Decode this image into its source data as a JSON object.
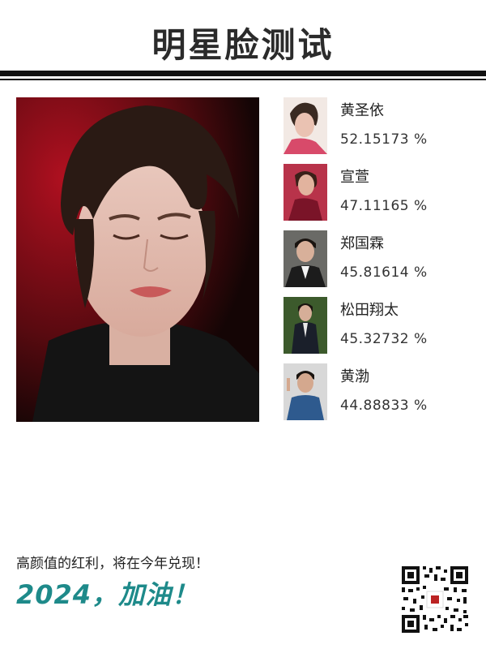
{
  "header": {
    "title": "明星脸测试"
  },
  "main_photo": {
    "alt": "portrait-photo"
  },
  "results": [
    {
      "name": "黄圣依",
      "score": "52.15173 %"
    },
    {
      "name": "宣萱",
      "score": "47.11165 %"
    },
    {
      "name": "郑国霖",
      "score": "45.81614 %"
    },
    {
      "name": "松田翔太",
      "score": "45.32732 %"
    },
    {
      "name": "黄渤",
      "score": "44.88833 %"
    }
  ],
  "footer": {
    "slogan": "高颜值的红利，将在今年兑现！",
    "slogan_big": "2024，加油！"
  },
  "colors": {
    "accent": "#1e8a8a",
    "rule": "#111111"
  }
}
